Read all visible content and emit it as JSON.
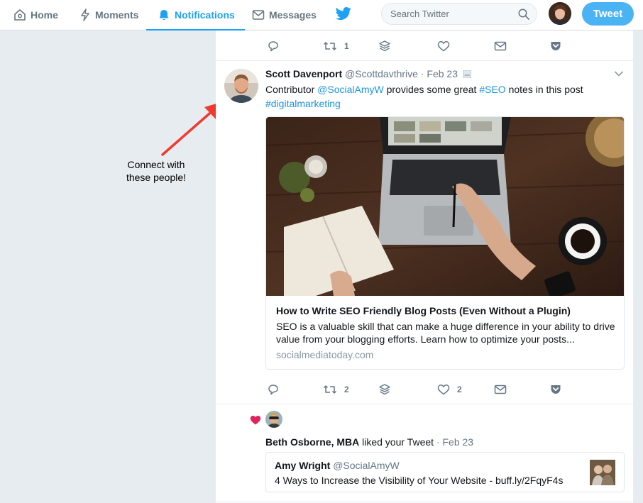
{
  "nav": {
    "home": "Home",
    "moments": "Moments",
    "notifications": "Notifications",
    "messages": "Messages",
    "search_placeholder": "Search Twitter",
    "tweet_button": "Tweet",
    "brand_icon": "twitter-bird-icon",
    "accent": "#1da1f2"
  },
  "prev_tweet_actions": {
    "retweet_count": "1"
  },
  "tweet": {
    "author_name": "Scott Davenport",
    "author_handle": "@Scottdavthrive",
    "separator": "·",
    "date": "Feb 23",
    "text_before": "Contributor ",
    "mention": "@SocialAmyW",
    "text_middle": " provides some great ",
    "hashtag1": "#SEO",
    "text_after": " notes in this post",
    "hashtag2": "#digitalmarketing",
    "retweet_count": "2",
    "like_count": "2",
    "card": {
      "title": "How to Write SEO Friendly Blog Posts (Even Without a Plugin)",
      "description": "SEO is a valuable skill that can make a huge difference in your ability to drive value from your blogging efforts. Learn how to optimize your posts...",
      "domain": "socialmediatoday.com"
    }
  },
  "like_notification": {
    "liker_name": "Beth Osborne, MBA",
    "action_text": " liked your Tweet",
    "separator": " · ",
    "date": "Feb 23",
    "heart_color": "#e0245e",
    "quoted": {
      "author_name": "Amy Wright",
      "author_handle": "@SocialAmyW",
      "text": "4 Ways to Increase the Visibility of Your Website - buff.ly/2FqyF4s"
    }
  },
  "annotation": {
    "line1": "Connect with",
    "line2": "these people!",
    "arrow_color": "#f03a2e"
  }
}
